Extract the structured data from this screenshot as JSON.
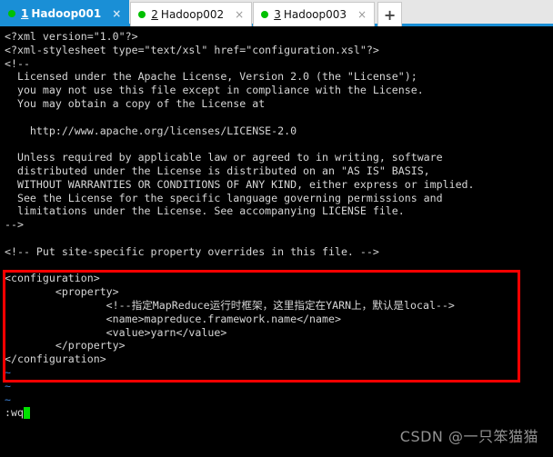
{
  "tabbar": {
    "tabs": [
      {
        "index": "1",
        "label": "Hadoop001",
        "close": "×",
        "active": true,
        "status_color": "#00c000"
      },
      {
        "index": "2",
        "label": "Hadoop002",
        "close": "×",
        "active": false,
        "status_color": "#00c000"
      },
      {
        "index": "3",
        "label": "Hadoop003",
        "close": "×",
        "active": false,
        "status_color": "#00c000"
      }
    ],
    "add_tab_label": "+",
    "active_tab_color": "#1a8fd6",
    "underline_color": "#1a8fd6"
  },
  "terminal": {
    "foreground": "#d6d6d6",
    "background": "#000000",
    "tilde_color": "#3b7fd4",
    "cursor_color": "#00e000",
    "lines": [
      "<?xml version=\"1.0\"?>",
      "<?xml-stylesheet type=\"text/xsl\" href=\"configuration.xsl\"?>",
      "<!--",
      "  Licensed under the Apache License, Version 2.0 (the \"License\");",
      "  you may not use this file except in compliance with the License.",
      "  You may obtain a copy of the License at",
      "",
      "    http://www.apache.org/licenses/LICENSE-2.0",
      "",
      "  Unless required by applicable law or agreed to in writing, software",
      "  distributed under the License is distributed on an \"AS IS\" BASIS,",
      "  WITHOUT WARRANTIES OR CONDITIONS OF ANY KIND, either express or implied.",
      "  See the License for the specific language governing permissions and",
      "  limitations under the License. See accompanying LICENSE file.",
      "-->",
      "",
      "<!-- Put site-specific property overrides in this file. -->",
      "",
      "<configuration>",
      "        <property>",
      "                <!--指定MapReduce运行时框架，这里指定在YARN上，默认是local-->",
      "                <name>mapreduce.framework.name</name>",
      "                <value>yarn</value>",
      "        </property>",
      "</configuration>"
    ],
    "empty_lines": [
      "~",
      "~",
      "~"
    ],
    "command": ":wq"
  },
  "highlight": {
    "color": "#ff0000",
    "label": "configuration-block-highlight"
  },
  "watermark": {
    "text": "CSDN @一只笨猫猫"
  }
}
